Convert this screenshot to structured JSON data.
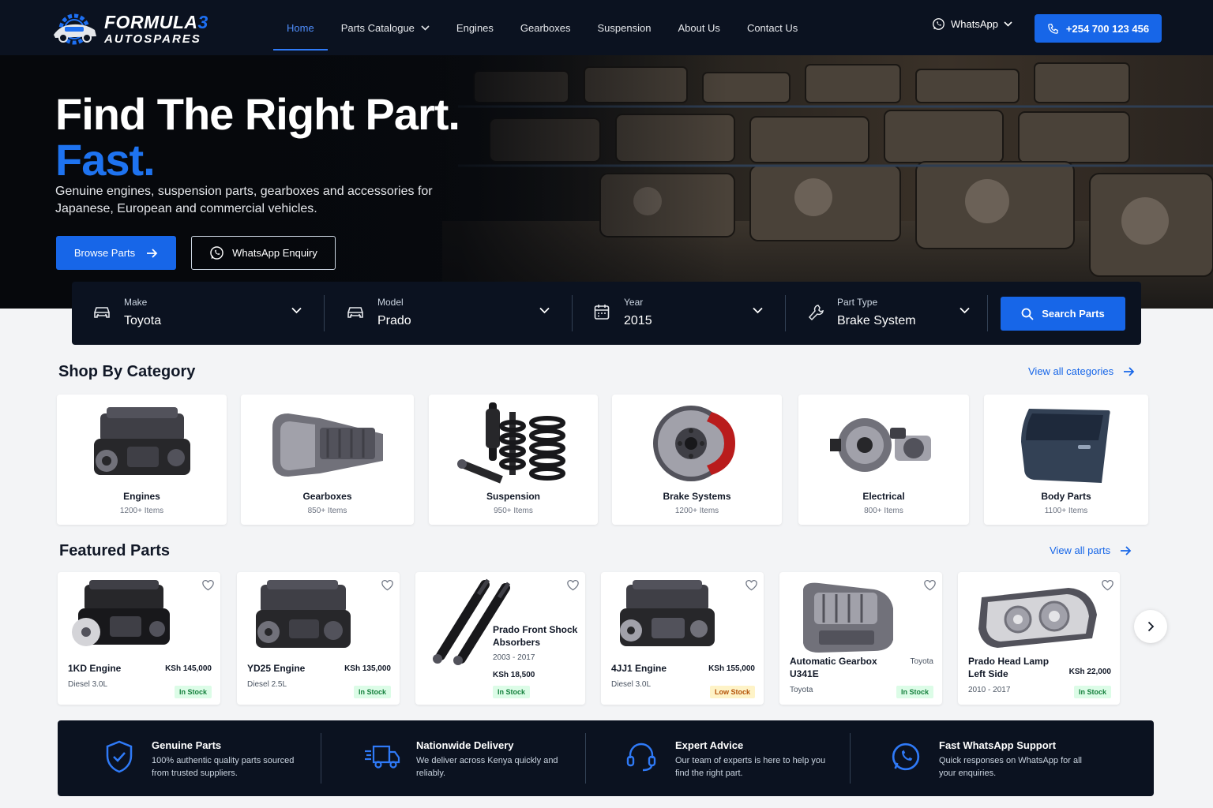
{
  "brand": {
    "name_a": "FORMULA",
    "name_b": "3",
    "tagline": "AUTOSPARES"
  },
  "nav": {
    "items": [
      "Home",
      "Parts Catalogue",
      "Engines",
      "Gearboxes",
      "Suspension",
      "About Us",
      "Contact Us"
    ],
    "active": "Home",
    "whatsapp": "WhatsApp",
    "phone": "+254 700 123 456"
  },
  "hero": {
    "title": "Find The Right Part.",
    "title_accent": "Fast.",
    "subtitle": "Genuine engines, suspension parts, gearboxes and accessories for Japanese, European and commercial vehicles.",
    "browse_label": "Browse Parts",
    "whatsapp_label": "WhatsApp Enquiry"
  },
  "search": {
    "fields": [
      {
        "label": "Make",
        "value": "Toyota",
        "icon": "car-icon"
      },
      {
        "label": "Model",
        "value": "Prado",
        "icon": "car-icon"
      },
      {
        "label": "Year",
        "value": "2015",
        "icon": "calendar-icon"
      },
      {
        "label": "Part Type",
        "value": "Brake System",
        "icon": "wrench-icon"
      }
    ],
    "button": "Search Parts"
  },
  "categories": {
    "title": "Shop By Category",
    "view_all": "View all categories",
    "items": [
      {
        "name": "Engines",
        "count": "1200+ Items"
      },
      {
        "name": "Gearboxes",
        "count": "850+ Items"
      },
      {
        "name": "Suspension",
        "count": "950+ Items"
      },
      {
        "name": "Brake Systems",
        "count": "1200+ Items"
      },
      {
        "name": "Electrical",
        "count": "800+ Items"
      },
      {
        "name": "Body Parts",
        "count": "1100+ Items"
      }
    ]
  },
  "featured": {
    "title": "Featured Parts",
    "view_all": "View all parts",
    "items": [
      {
        "name": "1KD Engine",
        "price": "KSh 145,000",
        "spec": "Diesel 3.0L",
        "stock": "In Stock"
      },
      {
        "name": "YD25 Engine",
        "price": "KSh 135,000",
        "spec": "Diesel 2.5L",
        "stock": "In Stock"
      },
      {
        "name": "Prado Front Shock Absorbers",
        "price": "KSh 18,500",
        "spec": "2003 - 2017",
        "stock": "In Stock"
      },
      {
        "name": "4JJ1 Engine",
        "price": "KSh 155,000",
        "spec": "Diesel 3.0L",
        "stock": "Low Stock"
      },
      {
        "name": "Automatic Gearbox U341E",
        "price": "Toyota",
        "spec": "Toyota",
        "stock": "In Stock"
      },
      {
        "name": "Prado Head Lamp Left Side",
        "price": "KSh 22,000",
        "spec": "2010 - 2017",
        "stock": "In Stock"
      }
    ]
  },
  "features": [
    {
      "title": "Genuine Parts",
      "desc": "100% authentic quality parts sourced from trusted suppliers.",
      "icon": "shield-check-icon"
    },
    {
      "title": "Nationwide Delivery",
      "desc": "We deliver across Kenya quickly and reliably.",
      "icon": "truck-icon"
    },
    {
      "title": "Expert Advice",
      "desc": "Our team of experts is here to help you find the right part.",
      "icon": "headset-icon"
    },
    {
      "title": "Fast WhatsApp Support",
      "desc": "Quick responses on WhatsApp for all your enquiries.",
      "icon": "whatsapp-icon"
    }
  ],
  "colors": {
    "accent": "#1766e8",
    "navy": "#0b1220",
    "in_stock": "#15803d",
    "low_stock": "#b45309"
  }
}
